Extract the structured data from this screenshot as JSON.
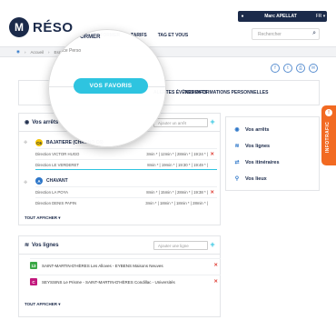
{
  "app": {
    "logo_letter": "M",
    "logo_text": "RÉSO"
  },
  "user": {
    "name": "Marc APELLAT",
    "lang": "FR ▾"
  },
  "nav": {
    "items": [
      "M'INFORMER",
      "TARIFS",
      "TAG ET VOUS"
    ]
  },
  "search": {
    "placeholder": "Rechercher"
  },
  "breadcrumb": {
    "home": "Accueil",
    "section": "Espace Perso"
  },
  "tabs": {
    "favorites": "VOS FAVORIS",
    "alerts": "ALERTES ÉVÈNEMENTS",
    "personal": "VOS INFORMATIONS PERSONNELLES"
  },
  "stops_panel": {
    "title": "Vos arrêts",
    "add_placeholder": "Ajouter un arrêt",
    "stops": [
      {
        "line": "C6",
        "line_color": "#f4c400",
        "name": "BAJATIERE (CHRONO C6)",
        "directions": [
          {
            "label": "Direction VICTOR HUGO",
            "times": "3min * | 12min * | 28min * | 19:24 * |"
          },
          {
            "label": "Direction LE VERDERET",
            "times": "8min * | 19min * | 19:30 * | 19:49 * |"
          }
        ]
      },
      {
        "line": "A",
        "line_color": "#2e77c9",
        "name": "CHAVANT",
        "directions": [
          {
            "label": "Direction LA POYA",
            "times": "8min * | 15min * | 28min * | 19:38 * |"
          },
          {
            "label": "Direction DENIS PAPIN",
            "times": "3min * | 18min * | 18min * | 28min * |"
          }
        ]
      }
    ],
    "show_all": "TOUT AFFICHER ▾"
  },
  "lines_panel": {
    "title": "Vos lignes",
    "add_placeholder": "Ajouter une ligne",
    "lines": [
      {
        "code": "13",
        "color": "#3aa845",
        "label": "SAINT-MARTIN-D'HÈRES Les Alloves - EYBENS Maisons Neuves"
      },
      {
        "code": "C",
        "color": "#c2187d",
        "label": "SEYSSINS Le Prisme - SAINT-MARTIN-D'HÈRES Condillac - Universités"
      }
    ],
    "show_all": "TOUT AFFICHER ▾"
  },
  "side_menu": {
    "items": [
      {
        "label": "Vos arrêts",
        "icon": "pin-icon"
      },
      {
        "label": "Vos lignes",
        "icon": "lines-icon"
      },
      {
        "label": "Vos itinéraires",
        "icon": "route-icon"
      },
      {
        "label": "Vos lieux",
        "icon": "place-icon"
      }
    ]
  },
  "infotrafic": {
    "label": "INFOTRAFIC"
  },
  "colors": {
    "navy": "#1b2a4a",
    "cyan": "#2ec4e0",
    "orange": "#f26a22",
    "red": "#e0433a"
  }
}
